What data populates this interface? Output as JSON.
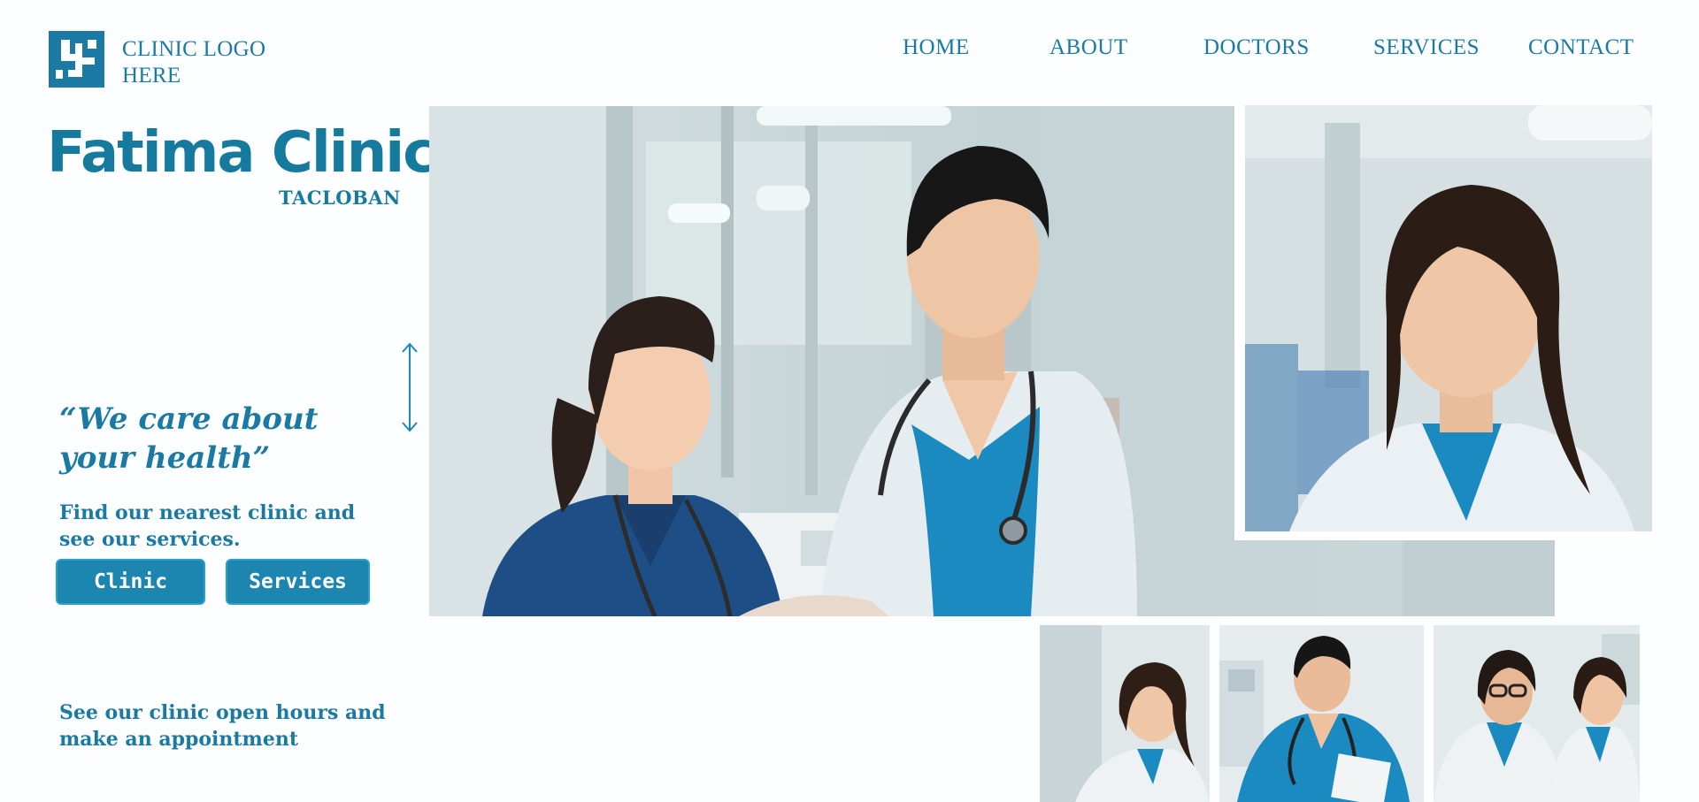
{
  "header": {
    "logo_text": "CLINIC LOGO HERE",
    "nav": [
      {
        "label": "HOME"
      },
      {
        "label": "ABOUT"
      },
      {
        "label": "DOCTORS"
      },
      {
        "label": "SERVICES"
      },
      {
        "label": "CONTACT"
      }
    ]
  },
  "brand": {
    "name": "Fatima Clinic",
    "location": "TACLOBAN"
  },
  "hero": {
    "tagline": "“We care about your health”",
    "intro": "Find our nearest clinic and see our services.",
    "buttons": {
      "clinic": "Clinic",
      "services": "Services"
    },
    "outro": "See our clinic open hours and make an appointment"
  },
  "colors": {
    "brand": "#157a9e",
    "button": "#1c86b1",
    "scrub_blue": "#1a8ac0",
    "scrub_navy": "#1d4f86"
  },
  "icons": {
    "logo": "clinic-logo-icon",
    "arrow": "vertical-resize-arrow-icon"
  }
}
